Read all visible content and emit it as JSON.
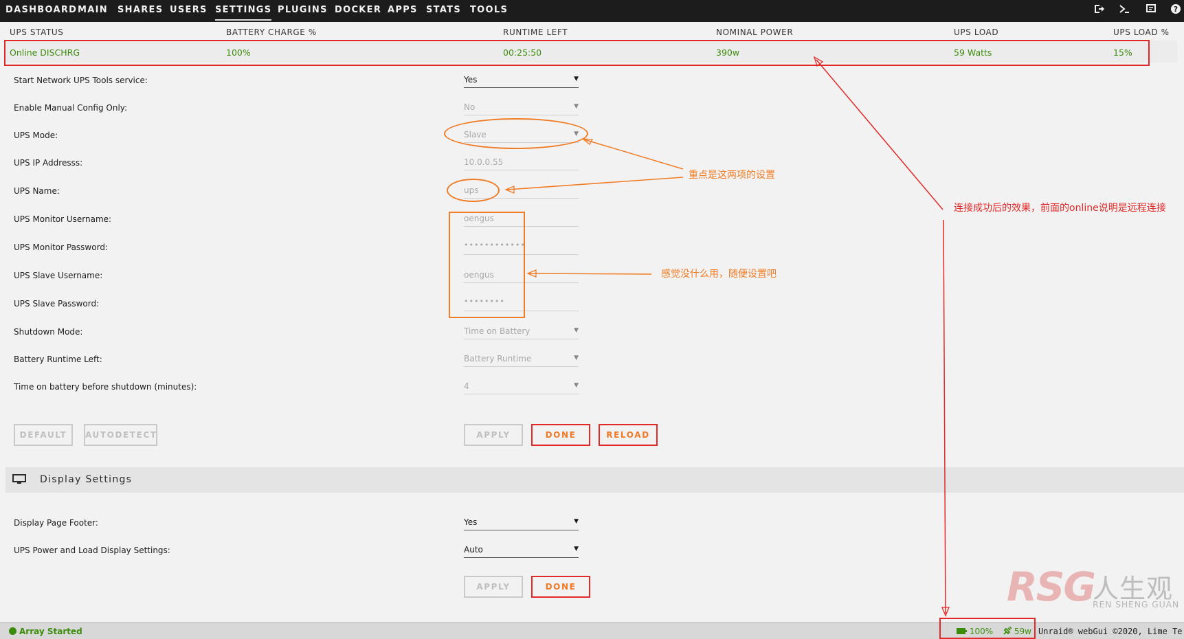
{
  "nav": {
    "items": [
      "DASHBOARD",
      "MAIN",
      "SHARES",
      "USERS",
      "SETTINGS",
      "PLUGINS",
      "DOCKER",
      "APPS",
      "STATS",
      "TOOLS"
    ],
    "active": "SETTINGS",
    "icons": [
      "logout-icon",
      "terminal-icon",
      "feedback-icon",
      "help-icon"
    ]
  },
  "ups_status": {
    "headers": [
      "UPS STATUS",
      "BATTERY CHARGE %",
      "RUNTIME LEFT",
      "NOMINAL POWER",
      "UPS LOAD",
      "UPS LOAD %"
    ],
    "values": [
      "Online DISCHRG",
      "100%",
      "00:25:50",
      "390w",
      "59 Watts",
      "15%"
    ]
  },
  "form": {
    "fields": [
      {
        "label": "Start Network UPS Tools service:",
        "value": "Yes"
      },
      {
        "label": "Enable Manual Config Only:",
        "value": "No"
      },
      {
        "label": "UPS Mode:",
        "value": "Slave"
      },
      {
        "label": "UPS IP Addresss:",
        "value": "10.0.0.55"
      },
      {
        "label": "UPS Name:",
        "value": "ups"
      },
      {
        "label": "UPS Monitor Username:",
        "value": "oengus"
      },
      {
        "label": "UPS Monitor Password:",
        "value": "••••••••••••"
      },
      {
        "label": "UPS Slave Username:",
        "value": "oengus"
      },
      {
        "label": "UPS Slave Password:",
        "value": "••••••••"
      },
      {
        "label": "Shutdown Mode:",
        "value": "Time on Battery"
      },
      {
        "label": "Battery Runtime Left:",
        "value": "Battery Runtime"
      },
      {
        "label": "Time on battery before shutdown (minutes):",
        "value": "4"
      }
    ],
    "buttons": {
      "default": "DEFAULT",
      "autodetect": "AUTODETECT",
      "apply": "APPLY",
      "done": "DONE",
      "reload": "RELOAD"
    }
  },
  "display_settings": {
    "title": "Display Settings",
    "fields": [
      {
        "label": "Display Page Footer:",
        "value": "Yes"
      },
      {
        "label": "UPS Power and Load Display Settings:",
        "value": "Auto"
      }
    ],
    "buttons": {
      "apply": "APPLY",
      "done": "DONE"
    }
  },
  "footer": {
    "status": "Array Started",
    "battery": "100%",
    "power": "59w",
    "copyright": "Unraid® webGui ©2020, Lime Te"
  },
  "annotations": {
    "key_settings": "重点是这两项的设置",
    "useless": "感觉没什么用，随便设置吧",
    "connected": "连接成功后的效果，前面的online说明是远程连接"
  },
  "watermark": {
    "logo": "RSG",
    "cn": "人生观",
    "en": "REN SHENG GUAN"
  },
  "colors": {
    "online_green": "#3b8c0a",
    "accent_orange": "#f07c25",
    "annotation_red": "#e22828"
  }
}
